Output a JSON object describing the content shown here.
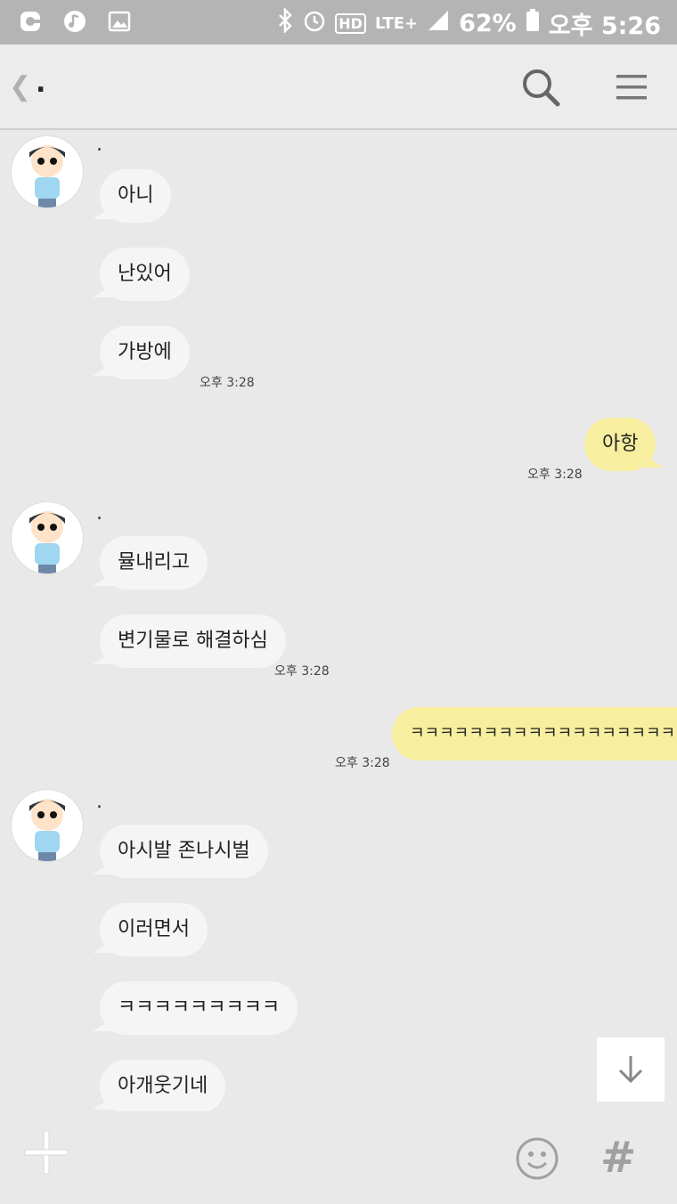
{
  "status_bar": {
    "battery": "62%",
    "time": "오후 5:26",
    "network": "LTE+"
  },
  "header": {
    "title": "."
  },
  "messages": [
    {
      "sender": ".",
      "text": "아니"
    },
    {
      "text": "난있어"
    },
    {
      "text": "가방에",
      "time": "오후 3:28"
    },
    {
      "text": "아항",
      "time": "오후 3:28",
      "outgoing": true
    },
    {
      "sender": ".",
      "text": "뮬내리고"
    },
    {
      "text": "변기물로 해결하심",
      "time": "오후 3:28"
    },
    {
      "text": "ㅋㅋㅋㅋㅋㅋㅋㅋㅋㅋㅋㅋㅋㅋㅋㅋㅋㅋㅋㅋㅋㅋㅋ",
      "time": "오후 3:28",
      "outgoing": true
    },
    {
      "sender": ".",
      "text": "아시발 존나시벌"
    },
    {
      "text": "이러면서"
    },
    {
      "text": "ㅋㅋㅋㅋㅋㅋㅋㅋㅋ"
    },
    {
      "text": "아개웃기네"
    }
  ],
  "colors": {
    "background": "#e9e9e9",
    "incoming_bubble": "#f5f5f5",
    "outgoing_bubble": "#f7ef9f",
    "status_bar": "#b4b4b4"
  },
  "icons": {
    "back": "chevron-left-icon",
    "search": "search-icon",
    "menu": "menu-icon",
    "scroll_down": "arrow-down-icon",
    "plus": "plus-icon",
    "emoji": "smiley-icon",
    "hashtag": "hashtag-icon"
  }
}
